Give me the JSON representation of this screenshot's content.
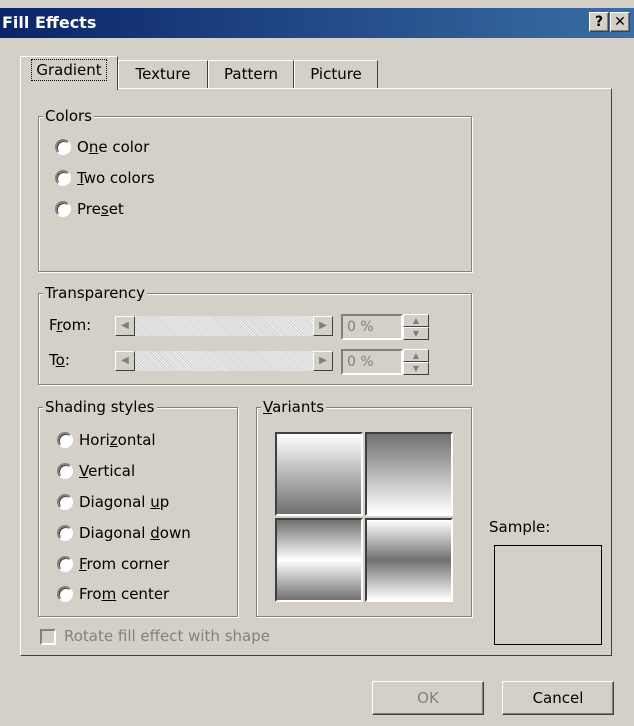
{
  "window": {
    "title": "Fill Effects",
    "help_label": "?",
    "close_label": "✕"
  },
  "tabs": [
    "Gradient",
    "Texture",
    "Pattern",
    "Picture"
  ],
  "colors_group": {
    "legend": "Colors",
    "options": [
      {
        "pre": "O",
        "key": "n",
        "post": "e color"
      },
      {
        "pre": "",
        "key": "T",
        "post": "wo colors"
      },
      {
        "pre": "Pre",
        "key": "s",
        "post": "et"
      }
    ]
  },
  "transparency_group": {
    "legend": "Transparency",
    "from": {
      "pre": "F",
      "key": "r",
      "post": "om:",
      "value": "0 %"
    },
    "to": {
      "pre": "T",
      "key": "o",
      "post": ":",
      "value": "0 %"
    }
  },
  "shading_group": {
    "legend": "Shading styles",
    "options": [
      {
        "pre": "Hori",
        "key": "z",
        "post": "ontal"
      },
      {
        "pre": "",
        "key": "V",
        "post": "ertical"
      },
      {
        "pre": "Diagonal ",
        "key": "u",
        "post": "p"
      },
      {
        "pre": "Diagonal ",
        "key": "d",
        "post": "own"
      },
      {
        "pre": "",
        "key": "F",
        "post": "rom corner"
      },
      {
        "pre": "Fro",
        "key": "m",
        "post": " center"
      }
    ]
  },
  "variants_group": {
    "pre": "",
    "key": "V",
    "post": "ariants"
  },
  "rotate_checkbox": {
    "label": "Rotate fill effect with shape",
    "checked": false,
    "enabled": false
  },
  "sample": {
    "label": "Sample:"
  },
  "buttons": {
    "ok": "OK",
    "cancel": "Cancel",
    "ok_enabled": false
  },
  "icons": {
    "radio": "radio-button-icon",
    "arrow_left": "◀",
    "arrow_right": "▶",
    "spin_up": "▲",
    "spin_down": "▼"
  },
  "colors": {
    "titlebar": "#0a246a",
    "face": "#d4d0c8",
    "disabled_text": "#808080"
  }
}
